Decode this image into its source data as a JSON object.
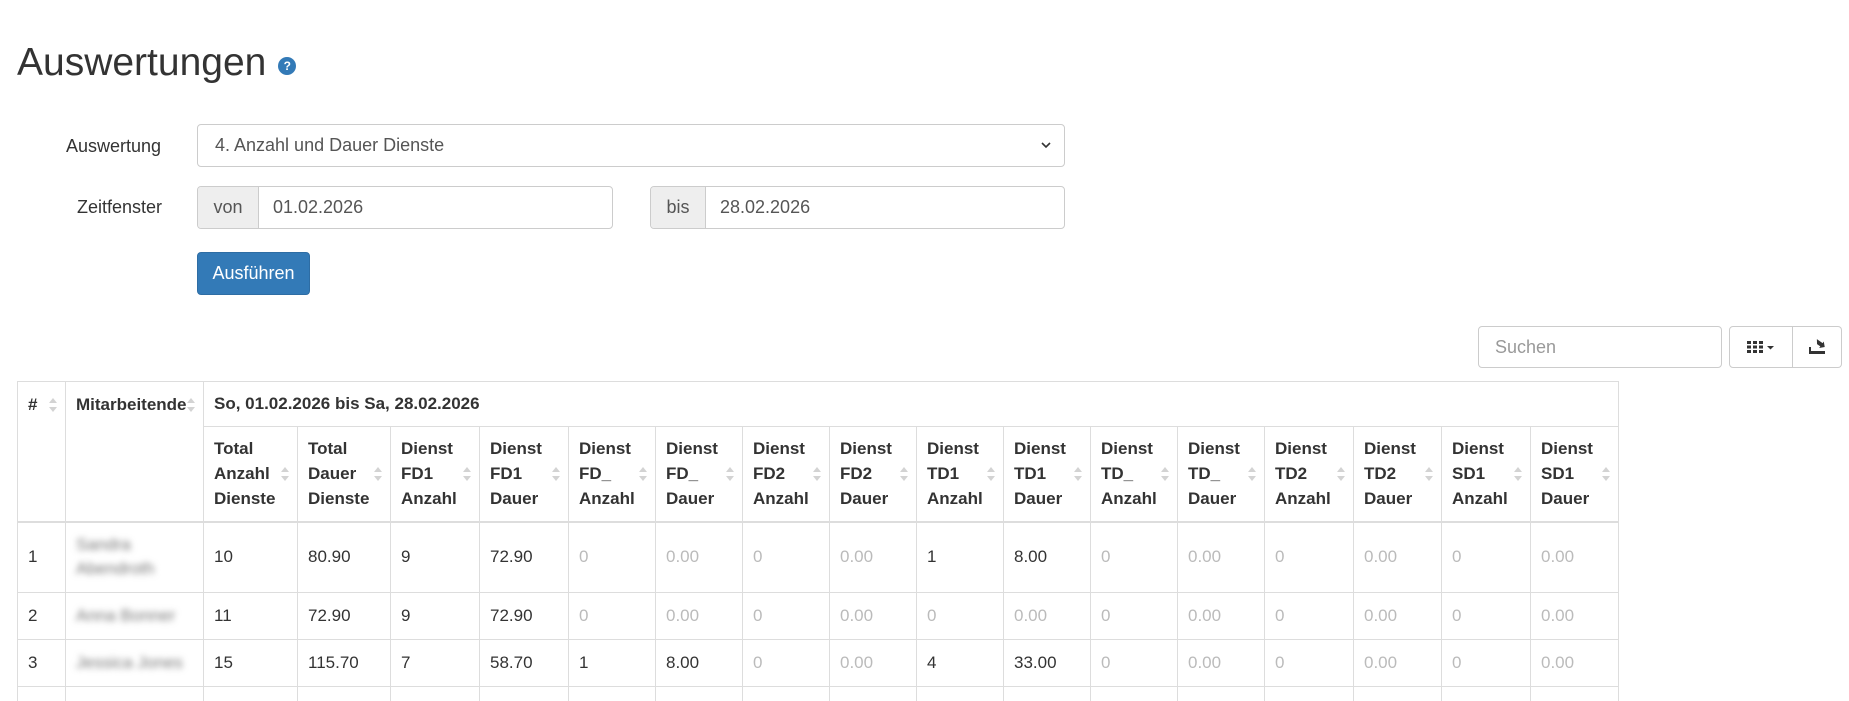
{
  "page": {
    "title": "Auswertungen"
  },
  "form": {
    "auswertung_label": "Auswertung",
    "auswertung_value": "4. Anzahl und Dauer Dienste",
    "zeitfenster_label": "Zeitfenster",
    "von_label": "von",
    "von_value": "01.02.2026",
    "bis_label": "bis",
    "bis_value": "28.02.2026",
    "run_button": "Ausführen"
  },
  "toolbar": {
    "search_placeholder": "Suchen",
    "columns_icon": "grid-icon",
    "export_icon": "export-icon"
  },
  "table": {
    "col_index": "#",
    "col_employee": "Mitarbeitende",
    "period_header": "So, 01.02.2026 bis Sa, 28.02.2026",
    "columns": [
      [
        "Total",
        "Anzahl",
        "Dienste"
      ],
      [
        "Total",
        "Dauer",
        "Dienste"
      ],
      [
        "Dienst",
        "FD1",
        "Anzahl"
      ],
      [
        "Dienst",
        "FD1",
        "Dauer"
      ],
      [
        "Dienst",
        "FD_",
        "Anzahl"
      ],
      [
        "Dienst",
        "FD_",
        "Dauer"
      ],
      [
        "Dienst",
        "FD2",
        "Anzahl"
      ],
      [
        "Dienst",
        "FD2",
        "Dauer"
      ],
      [
        "Dienst",
        "TD1",
        "Anzahl"
      ],
      [
        "Dienst",
        "TD1",
        "Dauer"
      ],
      [
        "Dienst",
        "TD_",
        "Anzahl"
      ],
      [
        "Dienst",
        "TD_",
        "Dauer"
      ],
      [
        "Dienst",
        "TD2",
        "Anzahl"
      ],
      [
        "Dienst",
        "TD2",
        "Dauer"
      ],
      [
        "Dienst",
        "SD1",
        "Anzahl"
      ],
      [
        "Dienst",
        "SD1",
        "Dauer"
      ]
    ],
    "rows": [
      {
        "index": "1",
        "name": "Sandra Abendroth",
        "values": [
          "10",
          "80.90",
          "9",
          "72.90",
          "0",
          "0.00",
          "0",
          "0.00",
          "1",
          "8.00",
          "0",
          "0.00",
          "0",
          "0.00",
          "0",
          "0.00"
        ]
      },
      {
        "index": "2",
        "name": "Anna Bonner",
        "values": [
          "11",
          "72.90",
          "9",
          "72.90",
          "0",
          "0.00",
          "0",
          "0.00",
          "0",
          "0.00",
          "0",
          "0.00",
          "0",
          "0.00",
          "0",
          "0.00"
        ]
      },
      {
        "index": "3",
        "name": "Jessica Jones",
        "values": [
          "15",
          "115.70",
          "7",
          "58.70",
          "1",
          "8.00",
          "0",
          "0.00",
          "4",
          "33.00",
          "0",
          "0.00",
          "0",
          "0.00",
          "0",
          "0.00"
        ]
      },
      {
        "index": "",
        "name": "",
        "values": [
          "",
          "",
          "",
          "",
          "",
          "",
          "",
          "",
          "",
          "",
          "",
          "",
          "",
          "",
          "",
          ""
        ]
      }
    ]
  }
}
